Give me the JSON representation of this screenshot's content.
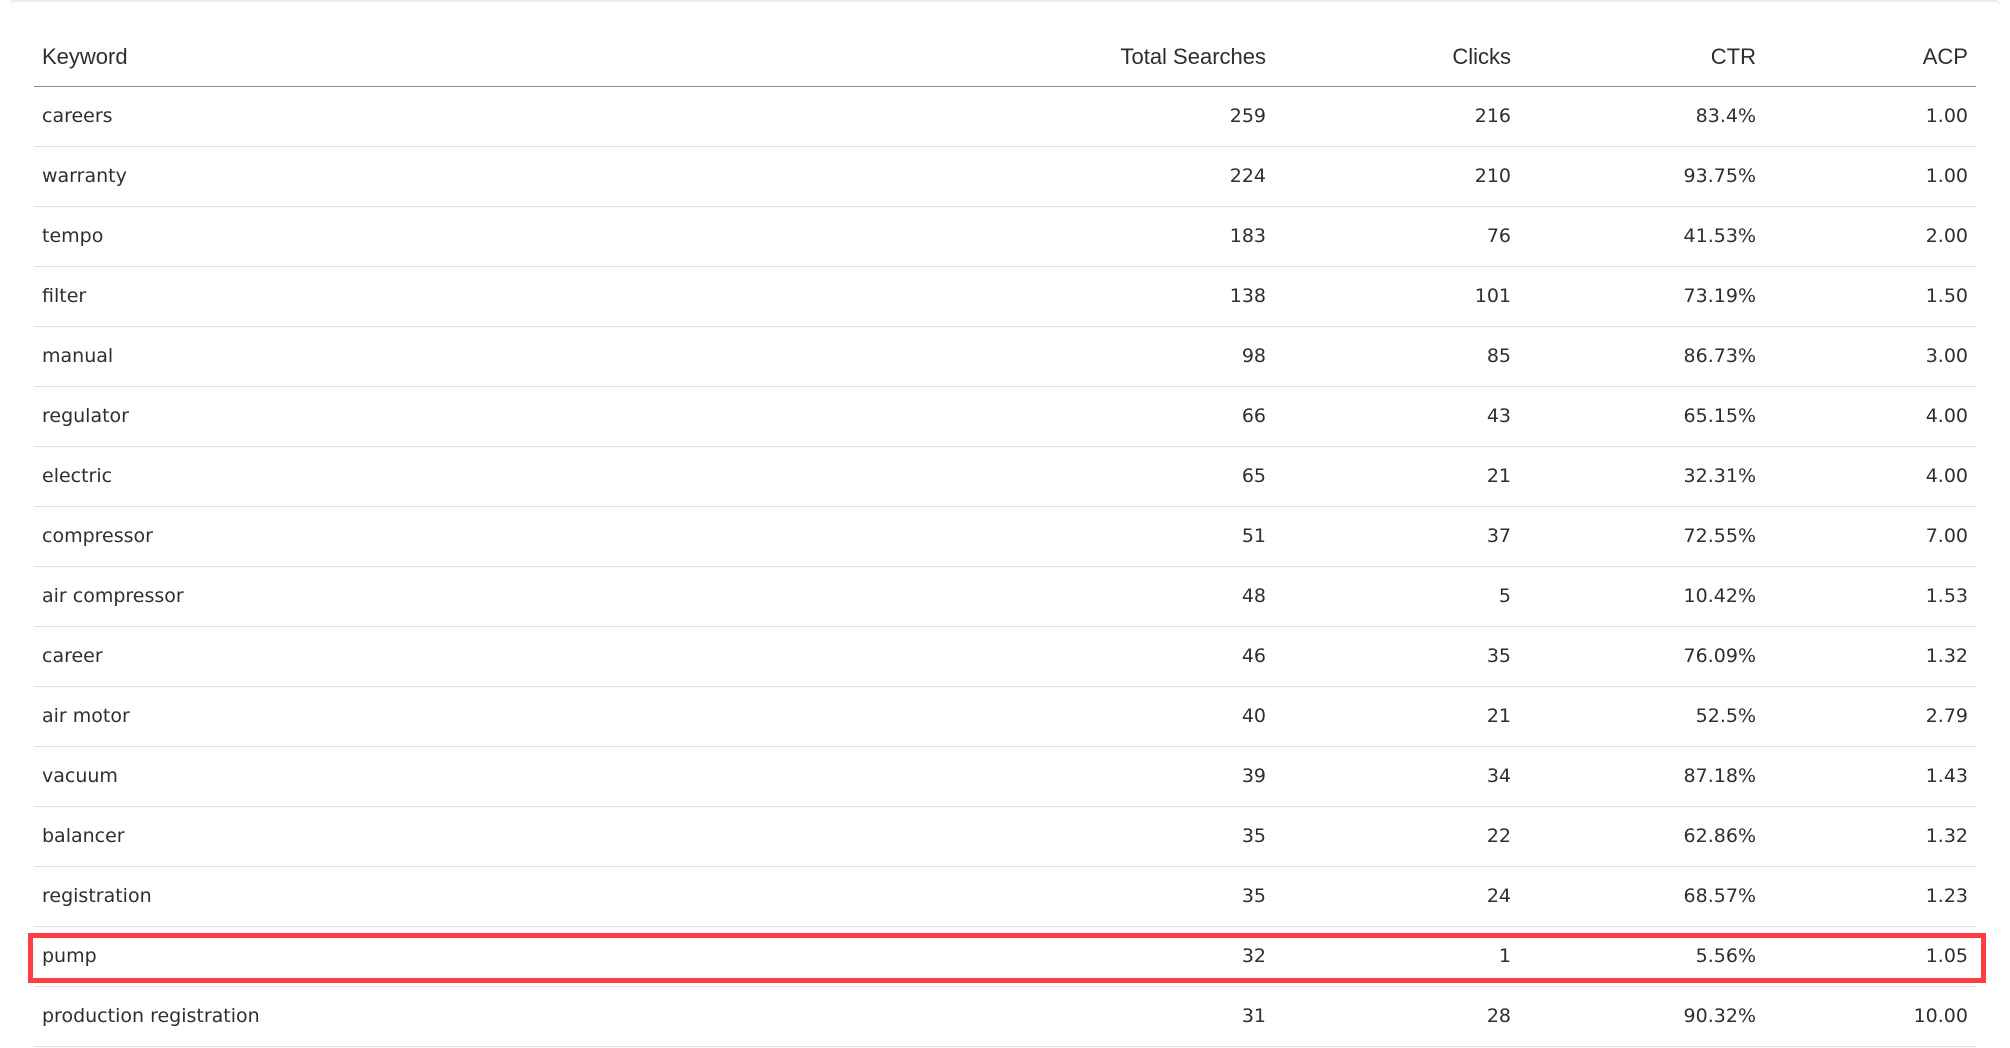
{
  "table": {
    "columns": [
      "Keyword",
      "Total Searches",
      "Clicks",
      "CTR",
      "ACP"
    ],
    "rows": [
      [
        "careers",
        "259",
        "216",
        "83.4%",
        "1.00"
      ],
      [
        "warranty",
        "224",
        "210",
        "93.75%",
        "1.00"
      ],
      [
        "tempo",
        "183",
        "76",
        "41.53%",
        "2.00"
      ],
      [
        "filter",
        "138",
        "101",
        "73.19%",
        "1.50"
      ],
      [
        "manual",
        "98",
        "85",
        "86.73%",
        "3.00"
      ],
      [
        "regulator",
        "66",
        "43",
        "65.15%",
        "4.00"
      ],
      [
        "electric",
        "65",
        "21",
        "32.31%",
        "4.00"
      ],
      [
        "compressor",
        "51",
        "37",
        "72.55%",
        "7.00"
      ],
      [
        "air compressor",
        "48",
        "5",
        "10.42%",
        "1.53"
      ],
      [
        "career",
        "46",
        "35",
        "76.09%",
        "1.32"
      ],
      [
        "air motor",
        "40",
        "21",
        "52.5%",
        "2.79"
      ],
      [
        "vacuum",
        "39",
        "34",
        "87.18%",
        "1.43"
      ],
      [
        "balancer",
        "35",
        "22",
        "62.86%",
        "1.32"
      ],
      [
        "registration",
        "35",
        "24",
        "68.57%",
        "1.23"
      ],
      [
        "pump",
        "32",
        "1",
        "5.56%",
        "1.05"
      ],
      [
        "production registration",
        "31",
        "28",
        "90.32%",
        "10.00"
      ]
    ]
  },
  "highlight": {
    "row_keyword": "pump",
    "color": "#ff3b43"
  }
}
